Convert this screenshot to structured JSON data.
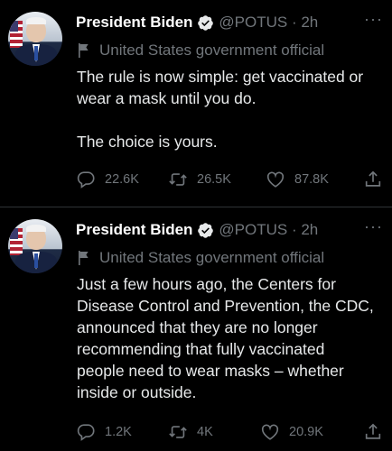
{
  "tweets": [
    {
      "author_name": "President Biden",
      "handle_time": "@POTUS · 2h",
      "label": "United States government official",
      "text": "The rule is now simple: get vaccinated or\nwear a mask until you do.\n\nThe choice is yours.",
      "replies": "22.6K",
      "retweets": "26.5K",
      "likes": "87.8K",
      "more": "···"
    },
    {
      "author_name": "President Biden",
      "handle_time": "@POTUS · 2h",
      "label": "United States government official",
      "text": "Just a few hours ago, the Centers for\nDisease Control and Prevention, the CDC,\nannounced that they are no longer\nrecommending that fully vaccinated\npeople need to wear masks – whether\ninside or outside.",
      "replies": "1.2K",
      "retweets": "4K",
      "likes": "20.9K",
      "more": "···"
    }
  ],
  "icons": [
    "avatar",
    "verified-badge-icon",
    "flag-icon",
    "more-icon",
    "reply-icon",
    "retweet-icon",
    "like-icon",
    "share-icon"
  ],
  "colors": {
    "background": "#000000",
    "text": "#e7e9ea",
    "secondary": "#71767b",
    "divider": "#2f3336"
  }
}
